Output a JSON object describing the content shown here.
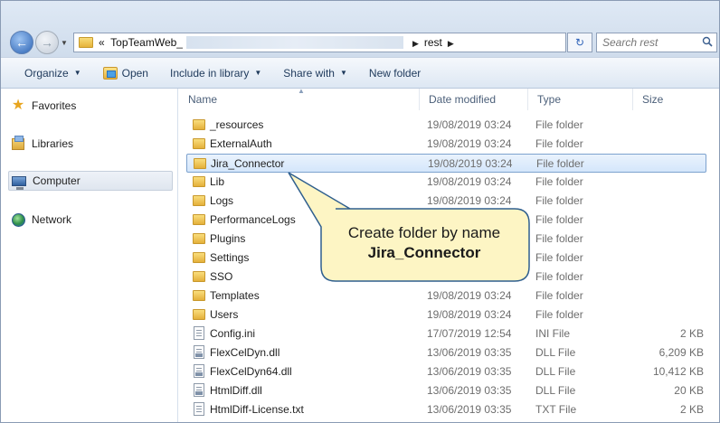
{
  "address": {
    "overflow": "«",
    "path_start": "TopTeamWeb_",
    "path_end": "rest",
    "search_placeholder": "Search rest"
  },
  "toolbar": {
    "organize": "Organize",
    "open": "Open",
    "include_in_library": "Include in library",
    "share_with": "Share with",
    "new_folder": "New folder"
  },
  "nav": {
    "favorites": "Favorites",
    "libraries": "Libraries",
    "computer": "Computer",
    "network": "Network"
  },
  "columns": {
    "name": "Name",
    "date_modified": "Date modified",
    "type": "Type",
    "size": "Size"
  },
  "files": [
    {
      "name": "_resources",
      "date": "19/08/2019 03:24",
      "type": "File folder",
      "size": "",
      "kind": "folder"
    },
    {
      "name": "ExternalAuth",
      "date": "19/08/2019 03:24",
      "type": "File folder",
      "size": "",
      "kind": "folder"
    },
    {
      "name": "Jira_Connector",
      "date": "19/08/2019 03:24",
      "type": "File folder",
      "size": "",
      "kind": "folder",
      "selected": true
    },
    {
      "name": "Lib",
      "date": "19/08/2019 03:24",
      "type": "File folder",
      "size": "",
      "kind": "folder"
    },
    {
      "name": "Logs",
      "date": "19/08/2019 03:24",
      "type": "File folder",
      "size": "",
      "kind": "folder"
    },
    {
      "name": "PerformanceLogs",
      "date": "",
      "type": "File folder",
      "size": "",
      "kind": "folder"
    },
    {
      "name": "Plugins",
      "date": "",
      "type": "File folder",
      "size": "",
      "kind": "folder"
    },
    {
      "name": "Settings",
      "date": "",
      "type": "File folder",
      "size": "",
      "kind": "folder"
    },
    {
      "name": "SSO",
      "date": "",
      "type": "File folder",
      "size": "",
      "kind": "folder"
    },
    {
      "name": "Templates",
      "date": "19/08/2019 03:24",
      "type": "File folder",
      "size": "",
      "kind": "folder"
    },
    {
      "name": "Users",
      "date": "19/08/2019 03:24",
      "type": "File folder",
      "size": "",
      "kind": "folder"
    },
    {
      "name": "Config.ini",
      "date": "17/07/2019 12:54",
      "type": "INI File",
      "size": "2 KB",
      "kind": "file"
    },
    {
      "name": "FlexCelDyn.dll",
      "date": "13/06/2019 03:35",
      "type": "DLL File",
      "size": "6,209 KB",
      "kind": "dll"
    },
    {
      "name": "FlexCelDyn64.dll",
      "date": "13/06/2019 03:35",
      "type": "DLL File",
      "size": "10,412 KB",
      "kind": "dll"
    },
    {
      "name": "HtmlDiff.dll",
      "date": "13/06/2019 03:35",
      "type": "DLL File",
      "size": "20 KB",
      "kind": "dll"
    },
    {
      "name": "HtmlDiff-License.txt",
      "date": "13/06/2019 03:35",
      "type": "TXT File",
      "size": "2 KB",
      "kind": "file"
    }
  ],
  "callout": {
    "line1": "Create folder by name",
    "line2": "Jira_Connector",
    "fill": "#fdf5c4",
    "stroke": "#2f5f8e"
  }
}
